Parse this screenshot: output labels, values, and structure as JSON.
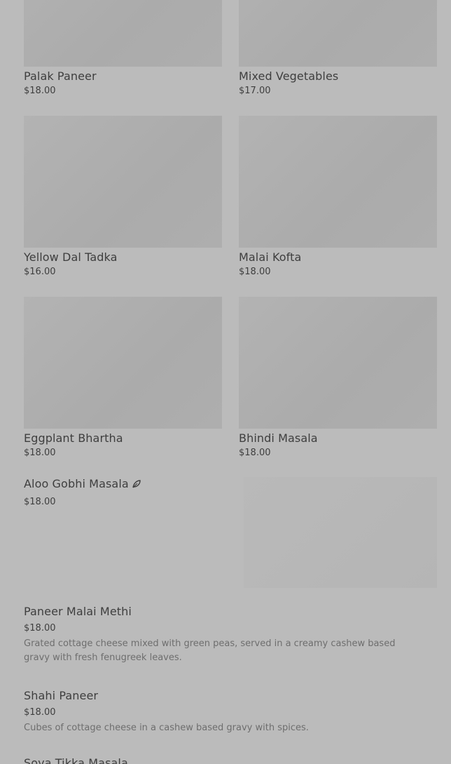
{
  "grid_items": [
    {
      "name": "Palak Paneer",
      "price": "$18.00"
    },
    {
      "name": "Mixed Vegetables",
      "price": "$17.00"
    },
    {
      "name": "Yellow Dal Tadka",
      "price": "$16.00"
    },
    {
      "name": "Malai Kofta",
      "price": "$18.00"
    },
    {
      "name": "Eggplant Bhartha",
      "price": "$18.00"
    },
    {
      "name": "Bhindi Masala",
      "price": "$18.00"
    }
  ],
  "featured": {
    "name": "Aloo Gobhi Masala",
    "price": "$18.00",
    "icon": "leaf-icon"
  },
  "list_items": [
    {
      "name": "Paneer Malai Methi",
      "price": "$18.00",
      "description": "Grated cottage cheese mixed with green peas, served in a creamy cashew based gravy with fresh fenugreek leaves."
    },
    {
      "name": "Shahi Paneer",
      "price": "$18.00",
      "description": "Cubes of cottage cheese in a cashew based gravy with spices."
    },
    {
      "name": "Soya Tikka Masala"
    }
  ]
}
